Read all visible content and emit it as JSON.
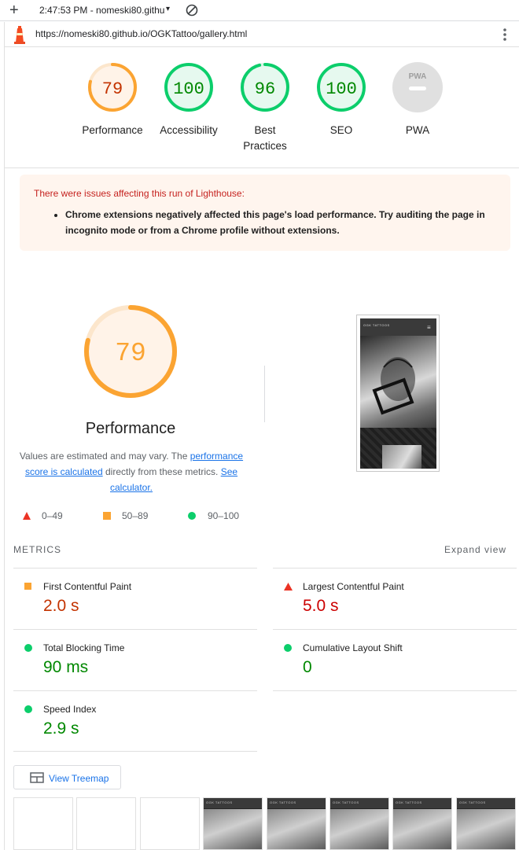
{
  "tab": {
    "time_title": "2:47:53 PM - nomeski80.githu",
    "caret": "▾"
  },
  "url": "https://nomeski80.github.io/OGKTattoo/gallery.html",
  "gauges": [
    {
      "score": "79",
      "label": "Performance",
      "status": "average"
    },
    {
      "score": "100",
      "label": "Accessibility",
      "status": "pass"
    },
    {
      "score": "96",
      "label": "Best Practices",
      "label_lines": [
        "Best",
        "Practices"
      ],
      "status": "pass"
    },
    {
      "score": "100",
      "label": "SEO",
      "status": "pass"
    },
    {
      "score": "",
      "badge": "PWA",
      "label": "PWA",
      "status": "na"
    }
  ],
  "warning": {
    "title": "There were issues affecting this run of Lighthouse:",
    "items": [
      "Chrome extensions negatively affected this page's load performance. Try auditing the page in incognito mode or from a Chrome profile without extensions."
    ]
  },
  "performance": {
    "score": "79",
    "title": "Performance",
    "desc_prefix": "Values are estimated and may vary. The ",
    "link1": "performance score is calculated",
    "desc_mid": " directly from these metrics. ",
    "link2": "See calculator."
  },
  "screenshot": {
    "site_name": "OGK TATTOOS",
    "menu_glyph": "≡"
  },
  "legend": [
    {
      "range": "0–49",
      "shape": "triangle",
      "color": "#eb3324"
    },
    {
      "range": "50–89",
      "shape": "square",
      "color": "#fba432"
    },
    {
      "range": "90–100",
      "shape": "circle",
      "color": "#0cce6b"
    }
  ],
  "metrics_header": "METRICS",
  "expand_label": "Expand view",
  "metrics": [
    {
      "label": "First Contentful Paint",
      "value": "2.0 s",
      "rating": "average"
    },
    {
      "label": "Largest Contentful Paint",
      "value": "5.0 s",
      "rating": "fail"
    },
    {
      "label": "Total Blocking Time",
      "value": "90 ms",
      "rating": "pass"
    },
    {
      "label": "Cumulative Layout Shift",
      "value": "0",
      "rating": "pass"
    },
    {
      "label": "Speed Index",
      "value": "2.9 s",
      "rating": "pass"
    }
  ],
  "colors": {
    "pass": "#0cce6b",
    "pass_text": "#008800",
    "average": "#fba432",
    "average_text": "#c33300",
    "fail": "#eb3324",
    "fail_text": "#cc0000",
    "link": "#1a73e8"
  },
  "treemap_label": "View Treemap",
  "filmstrip": {
    "frame_label": "OGK TATTOOS"
  }
}
